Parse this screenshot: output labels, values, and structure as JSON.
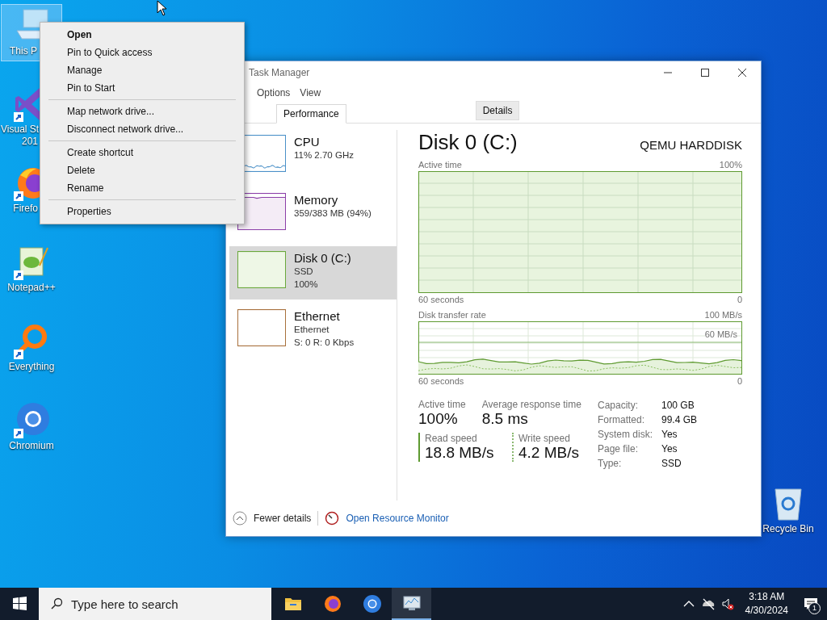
{
  "desktop_icons": [
    {
      "kind": "computer",
      "lines": [
        "This P"
      ],
      "selected": true,
      "covered": true
    },
    {
      "kind": "visual-studio",
      "lines": [
        "Visual St",
        "201"
      ],
      "selected": false,
      "covered": true
    },
    {
      "kind": "firefox",
      "lines": [
        "Firefo"
      ],
      "selected": false,
      "covered": true
    },
    {
      "kind": "notepad",
      "lines": [
        "Notepad++"
      ],
      "selected": false,
      "covered": false
    },
    {
      "kind": "everything",
      "lines": [
        "Everything"
      ],
      "selected": false,
      "covered": false
    },
    {
      "kind": "chromium",
      "lines": [
        "Chromium"
      ],
      "selected": false,
      "covered": false
    }
  ],
  "recycle_bin": {
    "label": "Recycle Bin"
  },
  "task_manager": {
    "title": "Task Manager",
    "menu": [
      "Options",
      "View"
    ],
    "tabs": [
      {
        "label": "Performance",
        "selected": true
      },
      {
        "label": "Details",
        "selected": false
      }
    ],
    "resources": [
      {
        "kind": "cpu",
        "name": "CPU",
        "lines": [
          "11%  2.70 GHz"
        ],
        "selected": false
      },
      {
        "kind": "memory",
        "name": "Memory",
        "lines": [
          "359/383 MB (94%)"
        ],
        "selected": false
      },
      {
        "kind": "disk",
        "name": "Disk 0 (C:)",
        "lines": [
          "SSD",
          "100%"
        ],
        "selected": true
      },
      {
        "kind": "ethernet",
        "name": "Ethernet",
        "lines": [
          "Ethernet",
          "S: 0 R: 0 Kbps"
        ],
        "selected": false
      }
    ],
    "detail": {
      "title": "Disk 0 (C:)",
      "model": "QEMU HARDDISK",
      "active_chart": {
        "label": "Active time",
        "max": "100%",
        "span": "60 seconds",
        "min": "0"
      },
      "transfer_chart": {
        "label": "Disk transfer rate",
        "max": "100 MB/s",
        "marker": "60 MB/s",
        "span": "60 seconds",
        "min": "0"
      },
      "stats": [
        {
          "label": "Active time",
          "value": "100%"
        },
        {
          "label": "Average response time",
          "value": "8.5 ms"
        }
      ],
      "speeds": [
        {
          "kind": "read",
          "label": "Read speed",
          "value": "18.8 MB/s"
        },
        {
          "kind": "write",
          "label": "Write speed",
          "value": "4.2 MB/s"
        }
      ],
      "properties": [
        {
          "label": "Capacity:",
          "value": "100 GB"
        },
        {
          "label": "Formatted:",
          "value": "99.4 GB"
        },
        {
          "label": "System disk:",
          "value": "Yes"
        },
        {
          "label": "Page file:",
          "value": "Yes"
        },
        {
          "label": "Type:",
          "value": "SSD"
        }
      ]
    },
    "fewer_details": "Fewer details",
    "resource_monitor": "Open Resource Monitor"
  },
  "context_menu": {
    "groups": [
      [
        {
          "label": "Open",
          "default": true
        },
        {
          "label": "Pin to Quick access",
          "default": false
        },
        {
          "label": "Manage",
          "default": false
        },
        {
          "label": "Pin to Start",
          "default": false
        }
      ],
      [
        {
          "label": "Map network drive...",
          "default": false
        },
        {
          "label": "Disconnect network drive...",
          "default": false
        }
      ],
      [
        {
          "label": "Create shortcut",
          "default": false
        },
        {
          "label": "Delete",
          "default": false
        },
        {
          "label": "Rename",
          "default": false
        }
      ],
      [
        {
          "label": "Properties",
          "default": false
        }
      ]
    ]
  },
  "taskbar": {
    "search_placeholder": "Type here to search",
    "apps": [
      {
        "kind": "files",
        "active": false
      },
      {
        "kind": "firefox",
        "active": false
      },
      {
        "kind": "chromium",
        "active": false
      },
      {
        "kind": "task-manager",
        "active": true
      }
    ],
    "time": "3:18 AM",
    "date": "4/30/2024",
    "notifications": "1"
  }
}
